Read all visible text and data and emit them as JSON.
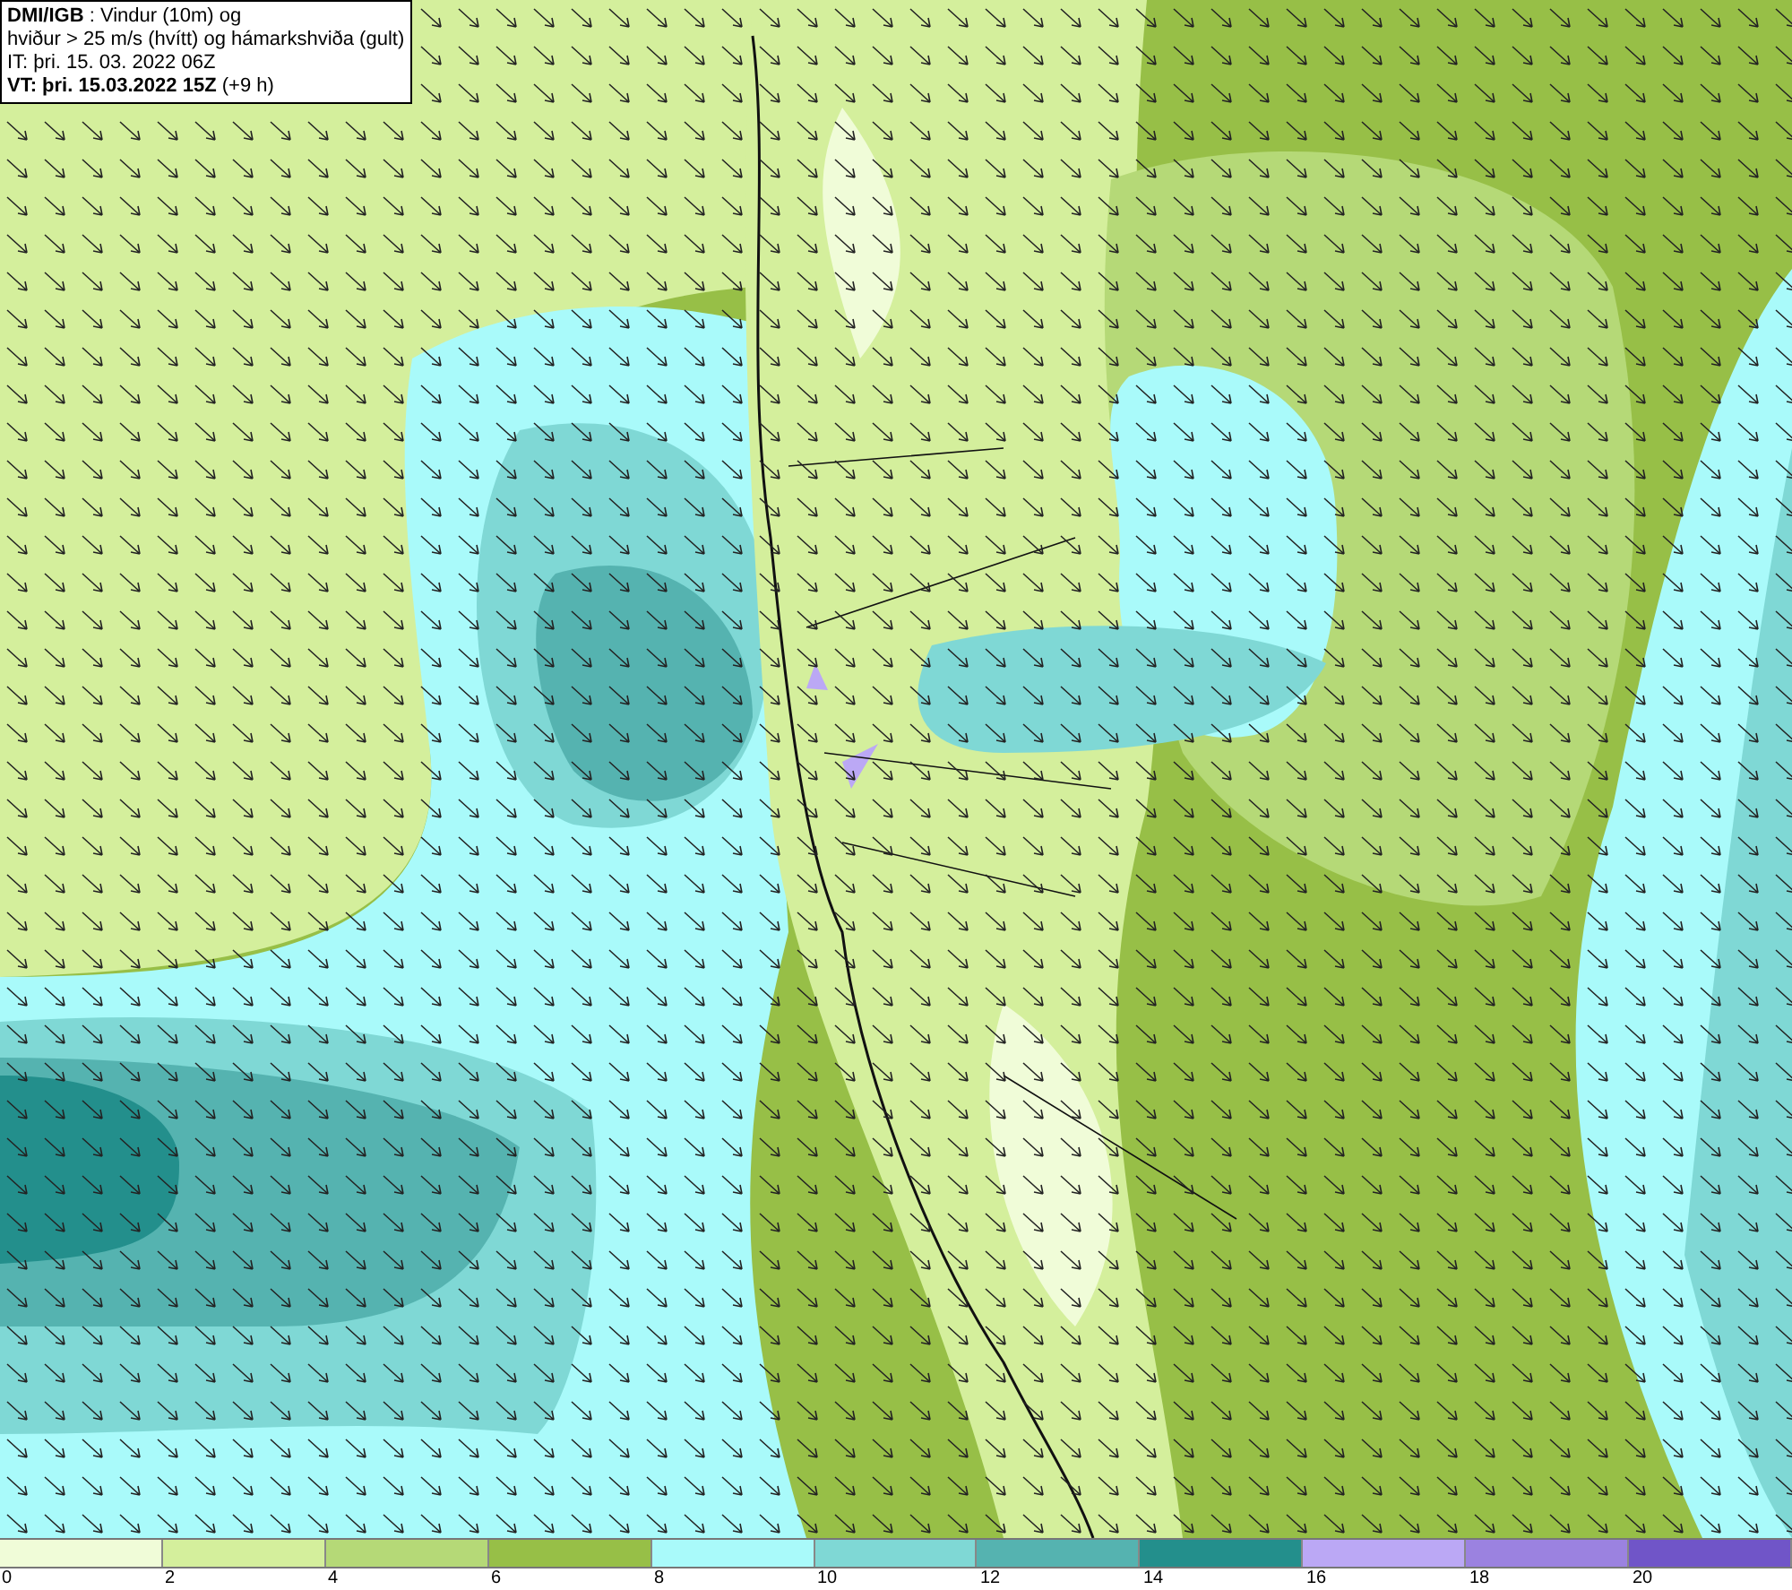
{
  "info_box": {
    "lines": [
      "**DMI/IGB** : Vindur (10m) og",
      "hviður > 25 m/s (hvítt) og hámarkshviða (gult)",
      "IT: þri. 15. 03. 2022 06Z",
      "**VT: þri. 15.03.2022 15Z** (+9 h)"
    ]
  },
  "legend": {
    "swatches": [
      {
        "color": "#f0fcd8"
      },
      {
        "color": "#d4ef9c"
      },
      {
        "color": "#b5d977"
      },
      {
        "color": "#97bf47"
      },
      {
        "color": "#a9fafa"
      },
      {
        "color": "#7fd8d5"
      },
      {
        "color": "#55b3b0"
      },
      {
        "color": "#238f8c"
      },
      {
        "color": "#bba8f5"
      },
      {
        "color": "#9b82e0"
      },
      {
        "color": "#7055c8"
      }
    ],
    "ticks": [
      "0",
      "2",
      "4",
      "6",
      "8",
      "10",
      "12",
      "14",
      "16",
      "18",
      "20"
    ]
  }
}
